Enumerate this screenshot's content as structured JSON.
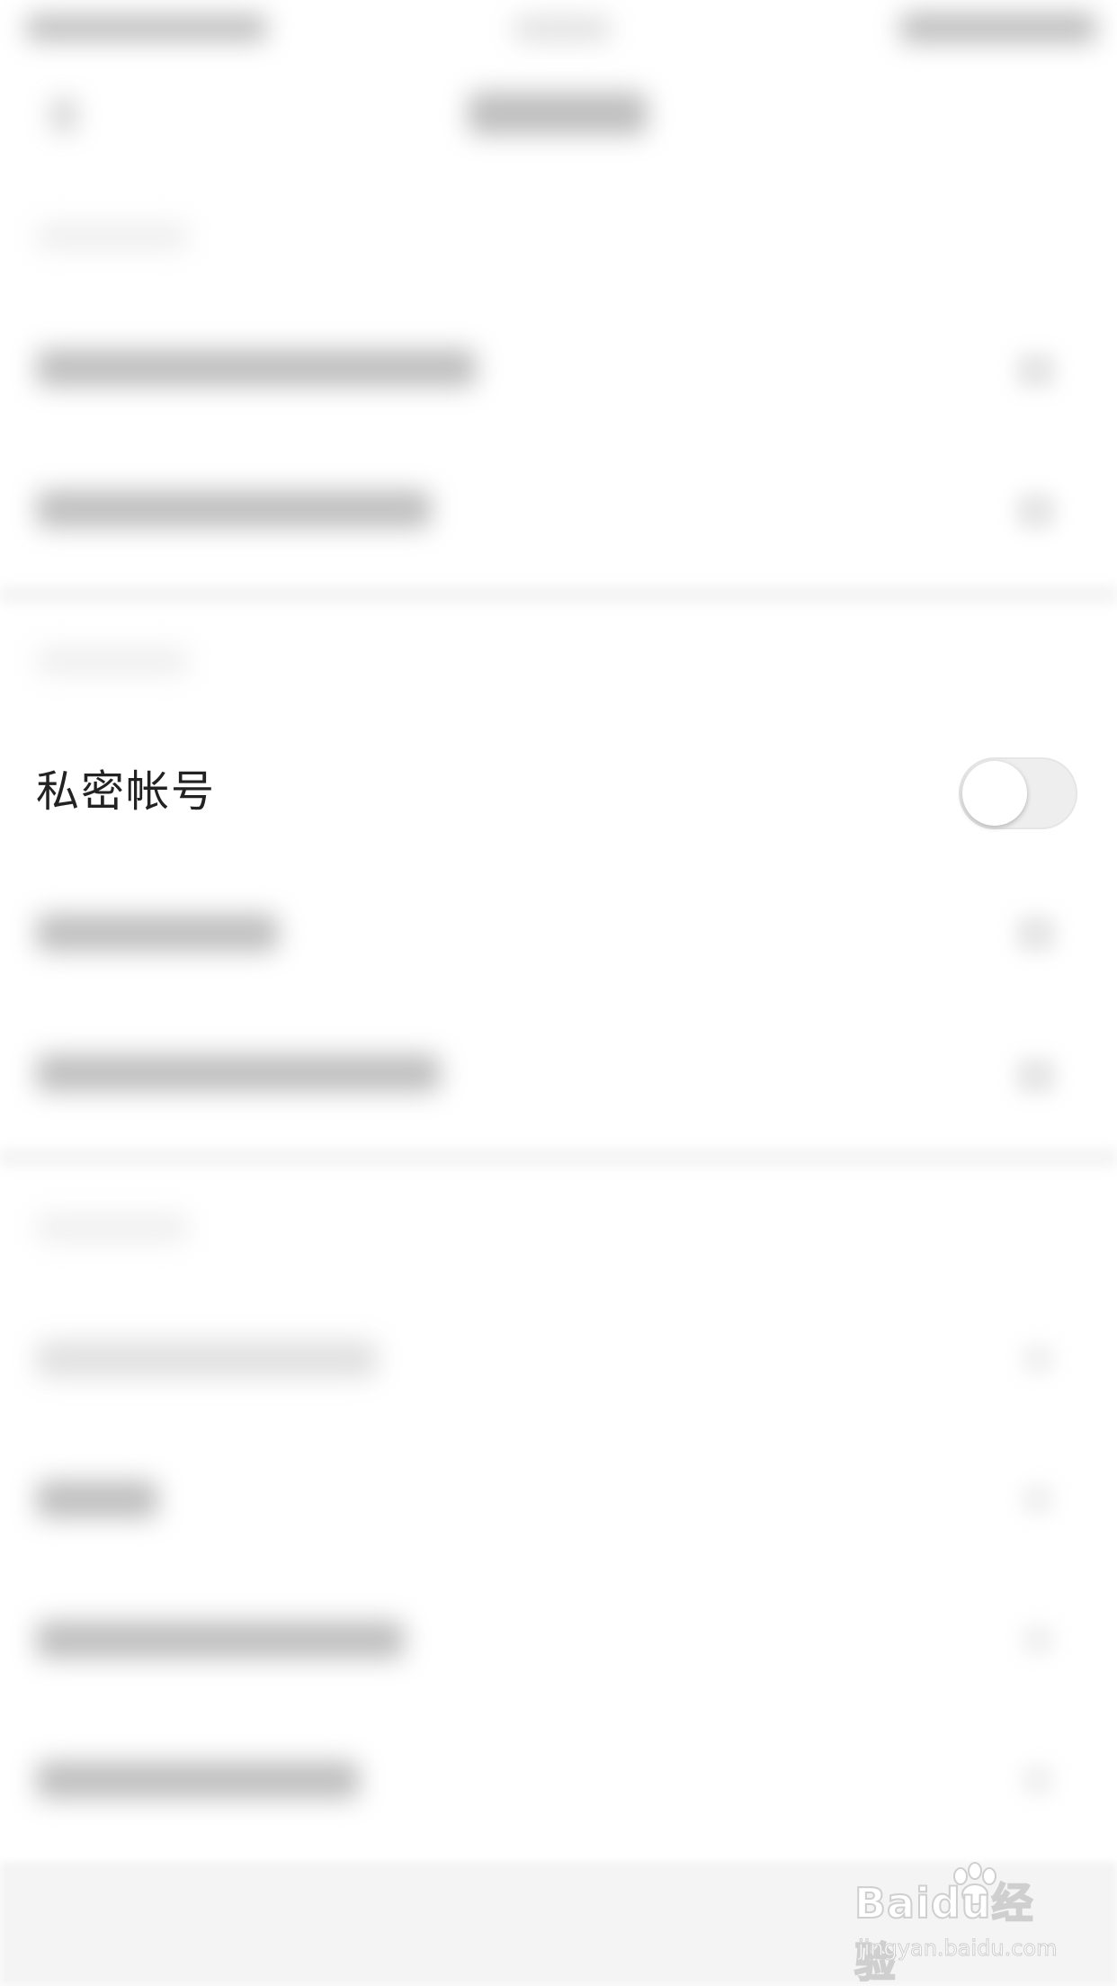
{
  "settings": {
    "private_account_label": "私密帐号",
    "private_account_enabled": false
  },
  "watermark": {
    "brand": "Baidu经验",
    "url": "jingyan.baidu.com"
  },
  "icons": {
    "toggle": "toggle-switch-off",
    "paw": "paw-icon"
  }
}
